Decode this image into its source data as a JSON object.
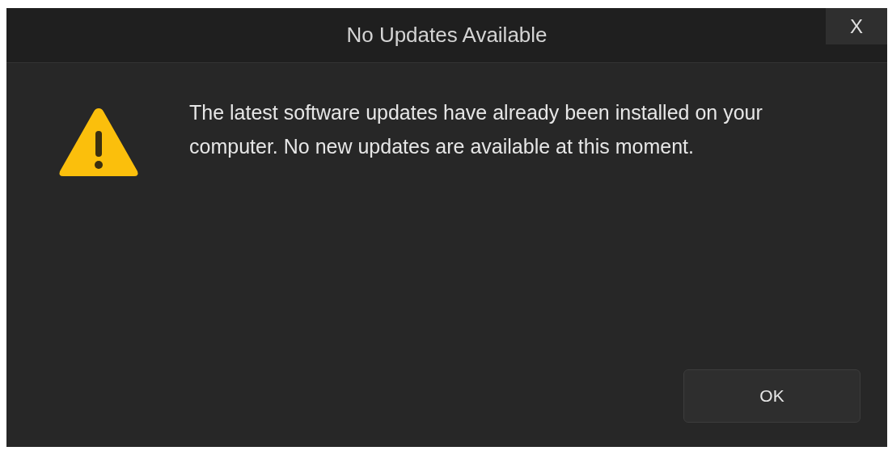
{
  "window": {
    "title": "No Updates Available",
    "close_label": "X"
  },
  "message": "The latest software updates have already been installed on your computer. No new updates are available at this moment.",
  "buttons": [
    "OK"
  ]
}
